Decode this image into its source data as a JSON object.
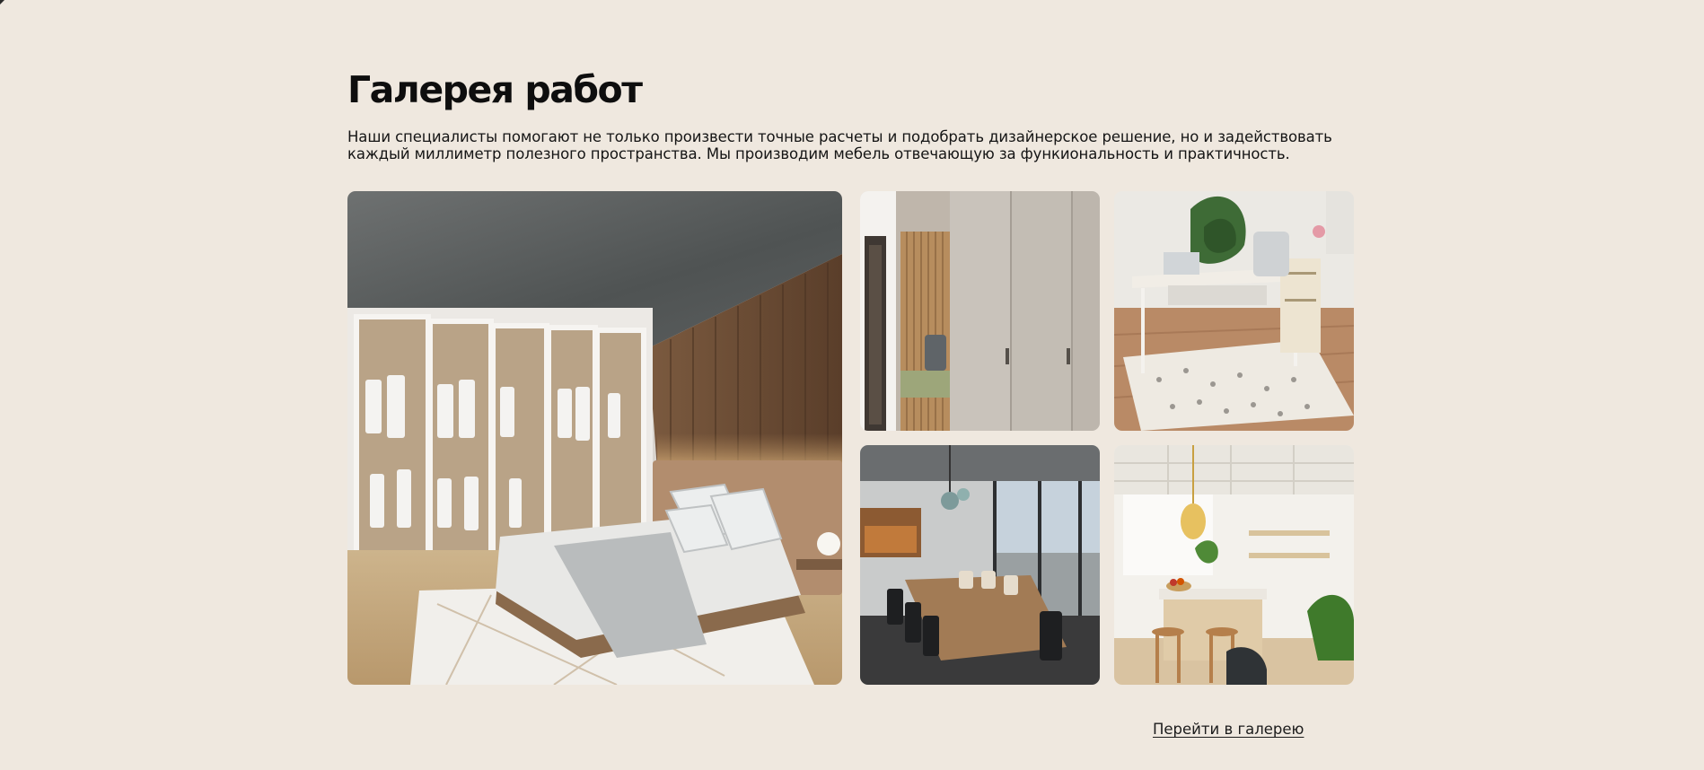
{
  "gallery": {
    "title": "Галерея работ",
    "description": "Наши специалисты помогают не только произвести точные расчеты и подобрать дизайнерское решение, но и задействовать каждый миллиметр полезного пространства. Мы производим мебель отвечающую за функиональность и практичность.",
    "link_label": "Перейти в галерею"
  },
  "colors": {
    "background": "#efe8df",
    "text": "#111111"
  }
}
